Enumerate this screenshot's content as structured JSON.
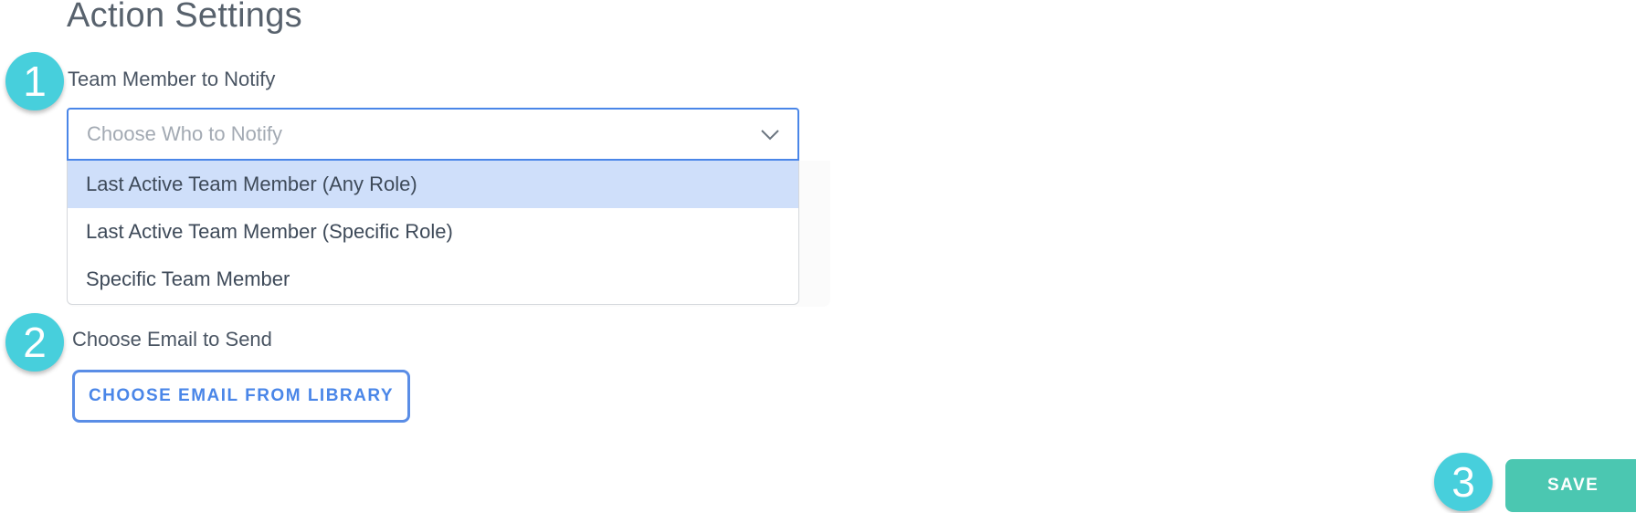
{
  "page": {
    "title": "Action Settings"
  },
  "steps": [
    {
      "number": "1"
    },
    {
      "number": "2"
    },
    {
      "number": "3"
    }
  ],
  "notify": {
    "label": "Team Member to Notify",
    "placeholder": "Choose Who to Notify",
    "options": [
      {
        "label": "Last Active Team Member (Any Role)",
        "highlighted": true
      },
      {
        "label": "Last Active Team Member (Specific Role)",
        "highlighted": false
      },
      {
        "label": "Specific Team Member",
        "highlighted": false
      }
    ]
  },
  "email": {
    "label": "Choose Email to Send",
    "library_button": "CHOOSE EMAIL FROM LIBRARY"
  },
  "actions": {
    "save_label": "SAVE"
  },
  "colors": {
    "badge": "#47cfdc",
    "primary_blue": "#4a86e8",
    "highlight": "#cfdffa",
    "save": "#4bc7b1"
  },
  "icons": {
    "select_toggle": "chevron-down-icon"
  }
}
